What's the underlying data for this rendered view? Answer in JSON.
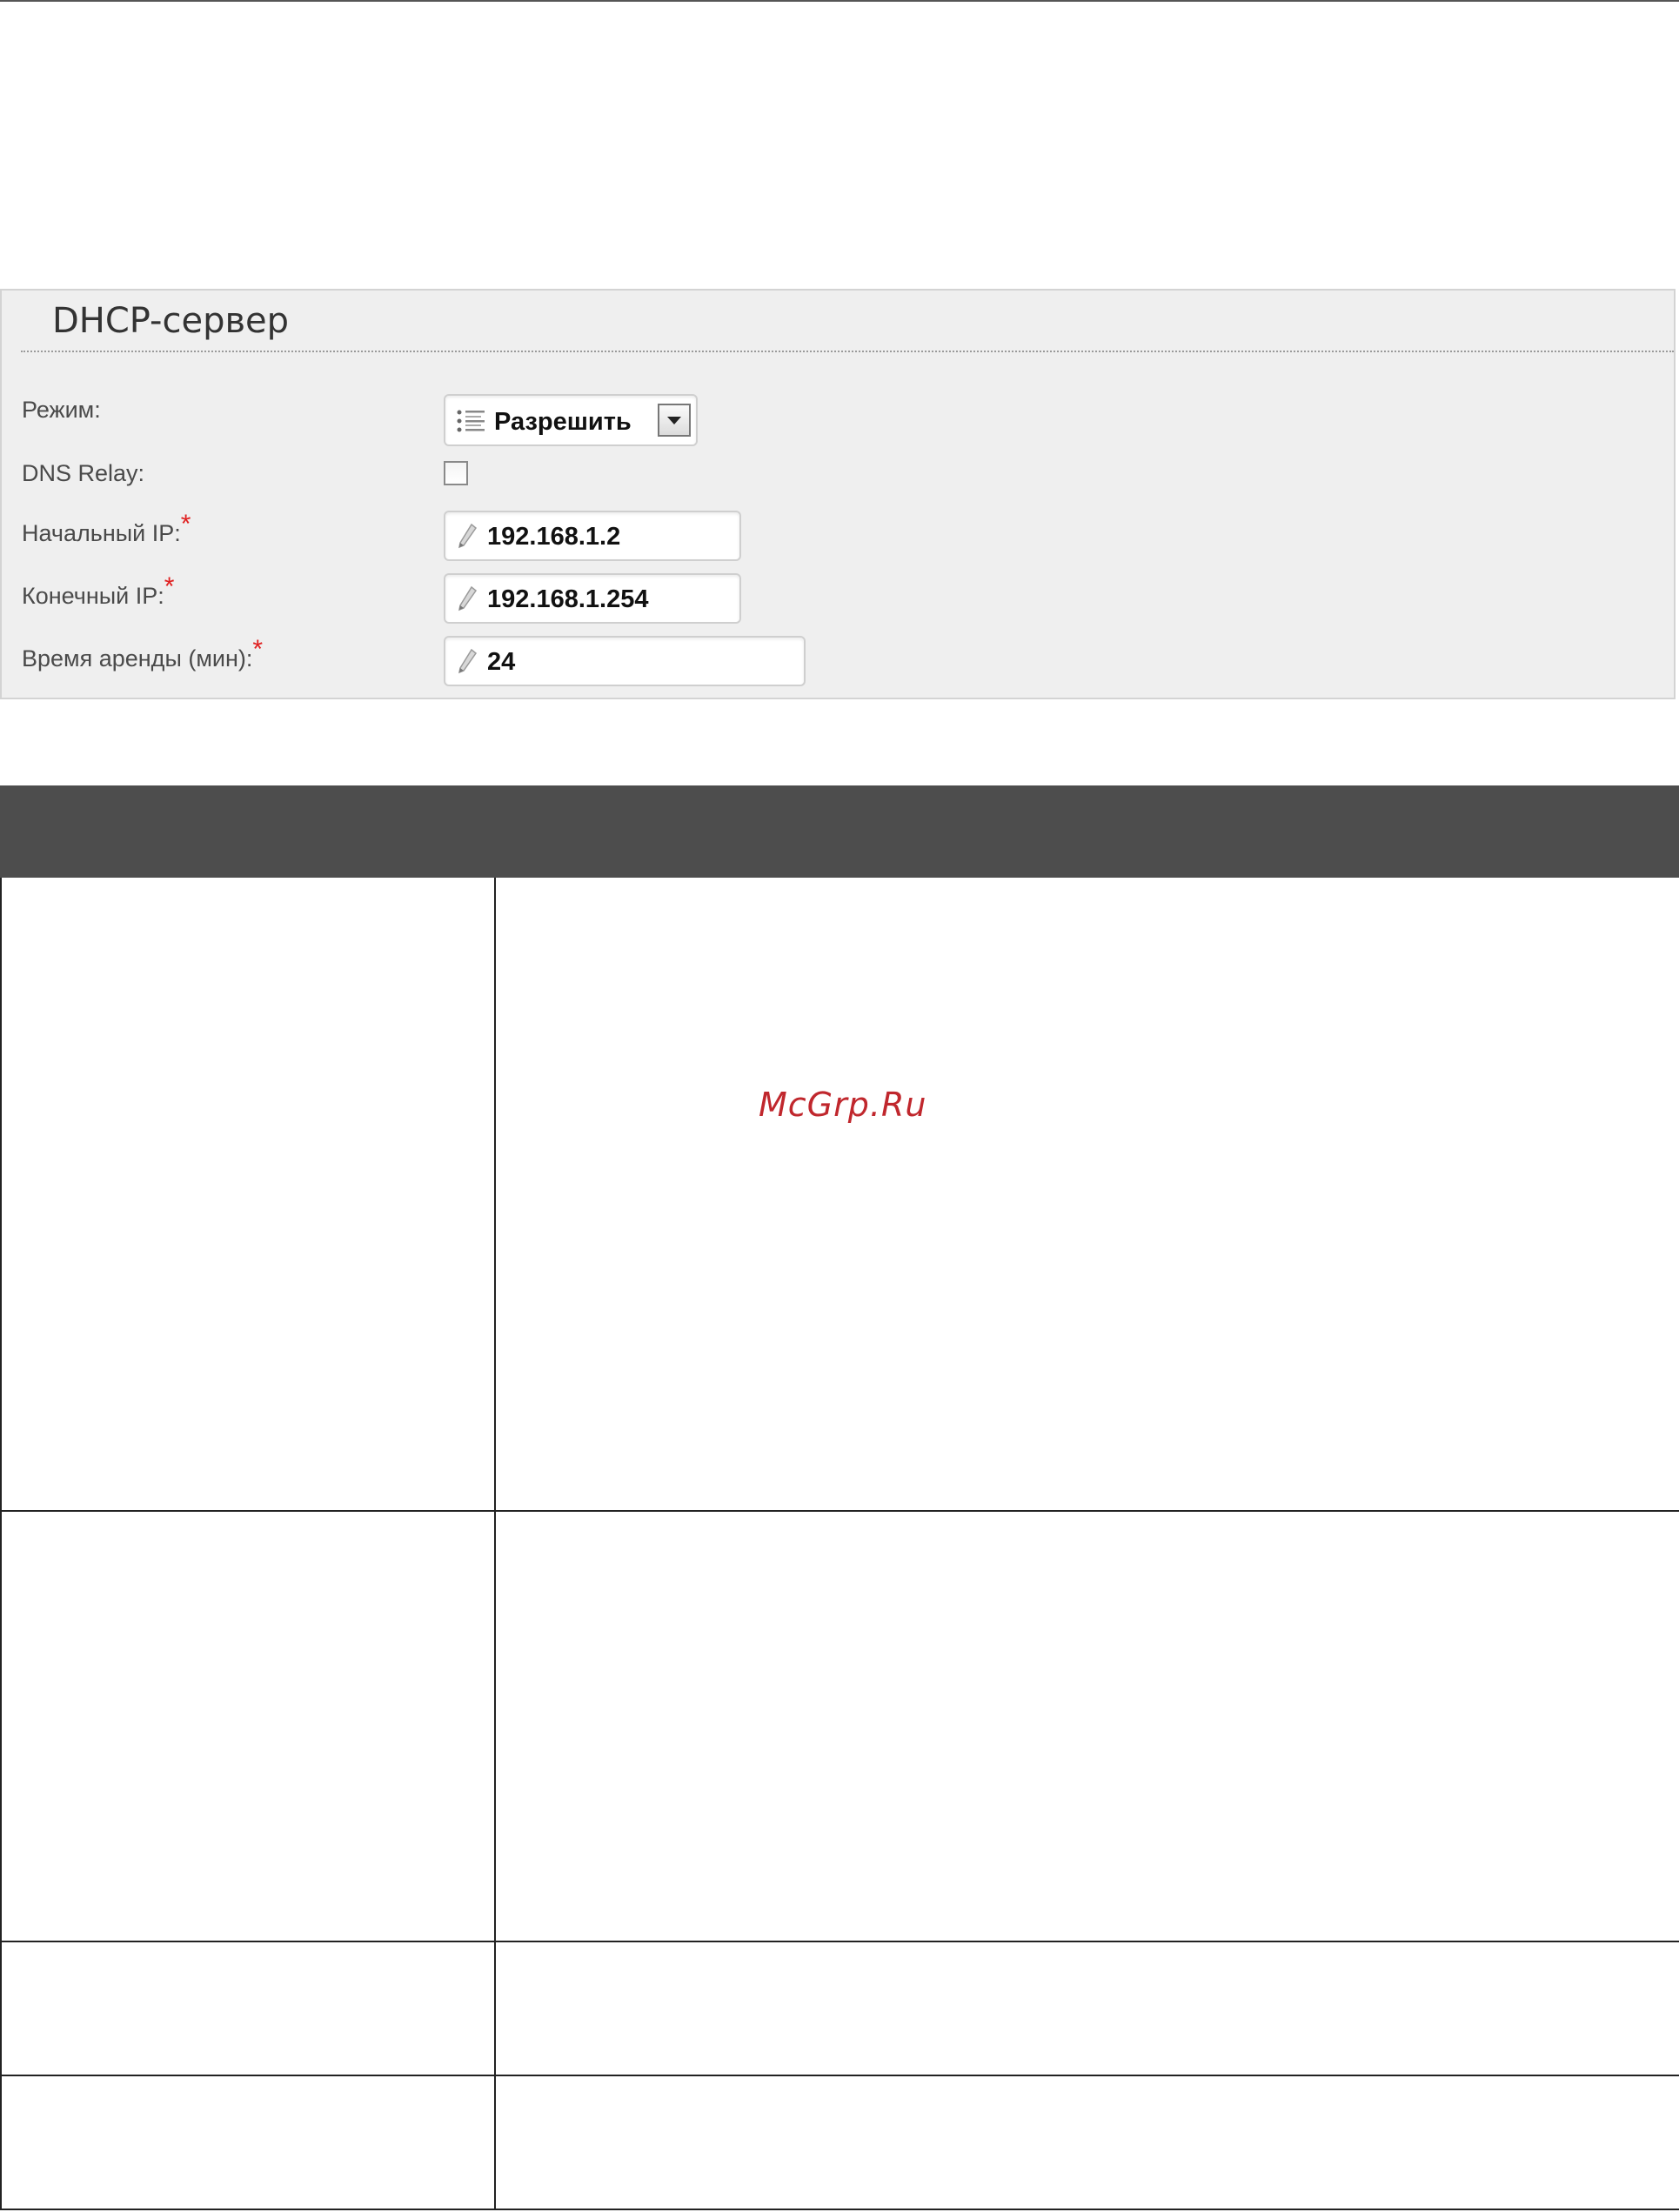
{
  "panel": {
    "title": "DHCP-сервер",
    "fields": [
      {
        "label": "Режим:",
        "required": false,
        "type": "select",
        "value": "Разрешить",
        "icon": "list-icon"
      },
      {
        "label": "DNS Relay:",
        "required": false,
        "type": "checkbox",
        "checked": false
      },
      {
        "label": "Начальный IP:",
        "required": true,
        "type": "text",
        "value": "192.168.1.2",
        "icon": "pencil-icon"
      },
      {
        "label": "Конечный IP:",
        "required": true,
        "type": "text",
        "value": "192.168.1.254",
        "icon": "pencil-icon"
      },
      {
        "label": "Время аренды (мин):",
        "required": true,
        "type": "text",
        "value": "24",
        "icon": "pencil-icon"
      }
    ],
    "required_marker": "*"
  },
  "table": {
    "header_color": "#4d4d4d",
    "rows": 4
  },
  "watermark": "McGrp.Ru",
  "colors": {
    "panel_bg": "#efefef",
    "required": "#e02020",
    "watermark": "#c0272d"
  }
}
